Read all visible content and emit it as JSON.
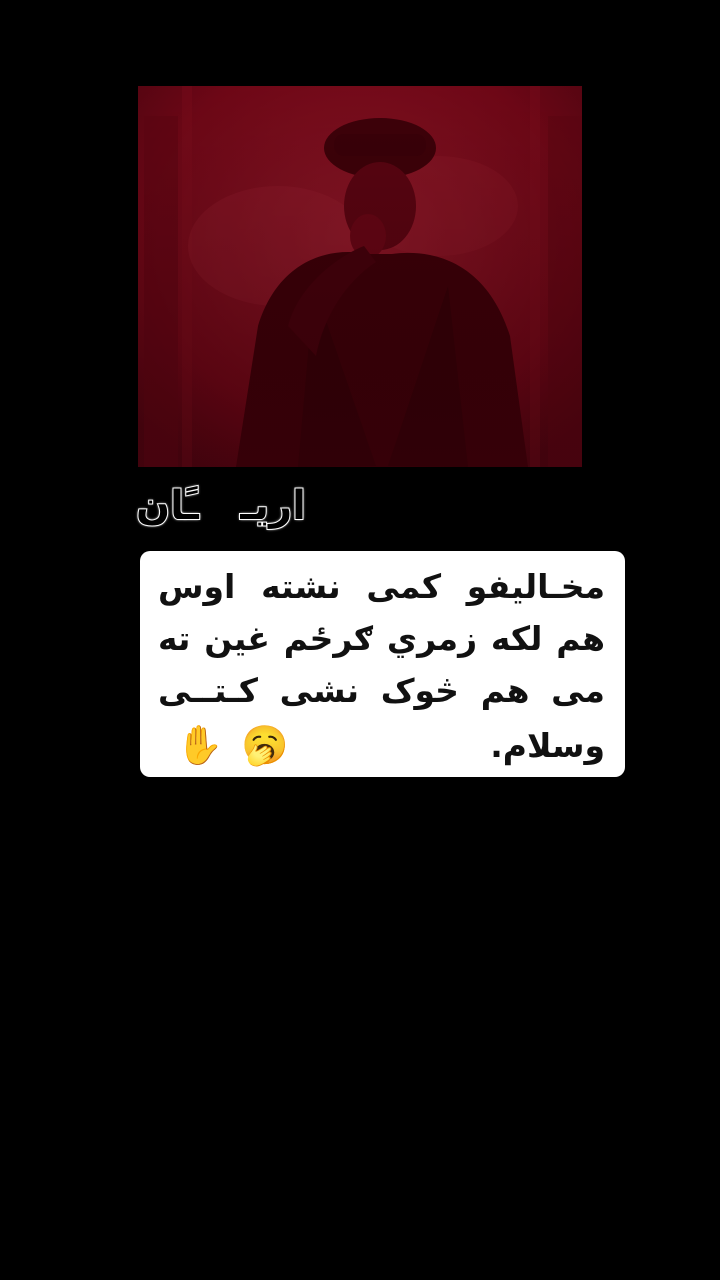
{
  "background_color": "#000000",
  "video": {
    "tint_color": "#6e0716",
    "subject": "man in flat cap and suit, red tinted"
  },
  "username": {
    "before": "اريـ",
    "emoji": "😏",
    "after": "ـًان"
  },
  "caption": {
    "lines": [
      "مخـاليفو كمى نشته اوس",
      "هم لكه زمري ګرځم غين ته",
      "مى هم څوک نشى کـتــى"
    ],
    "last_line": "وسلام.",
    "emojis": [
      "🥱",
      "✋"
    ]
  }
}
